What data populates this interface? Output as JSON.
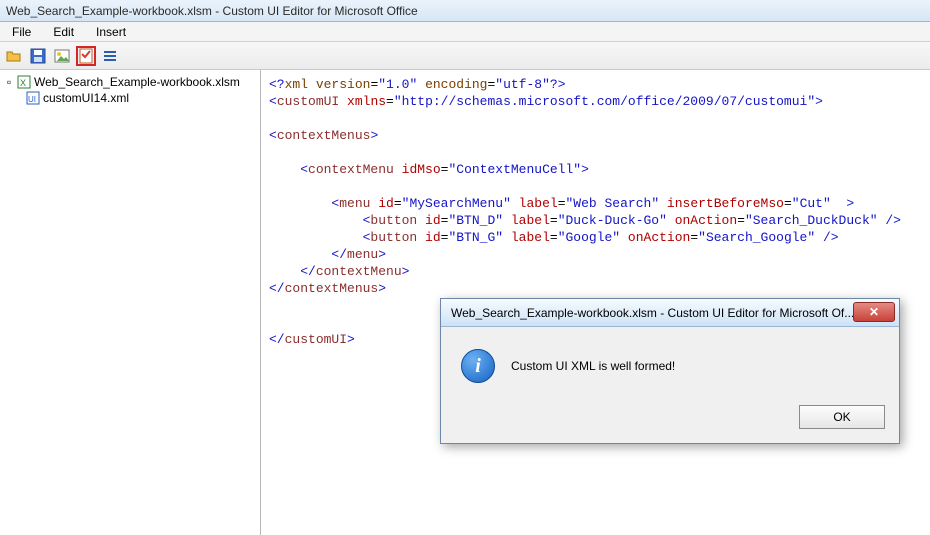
{
  "window": {
    "title": "Web_Search_Example-workbook.xlsm - Custom UI Editor for Microsoft Office"
  },
  "menu": {
    "file": "File",
    "edit": "Edit",
    "insert": "Insert"
  },
  "toolbar_icons": [
    "open",
    "save",
    "image",
    "validate",
    "generate"
  ],
  "tree": {
    "root": "Web_Search_Example-workbook.xlsm",
    "child": "customUI14.xml"
  },
  "xml": {
    "l1": {
      "a": "<?",
      "b": "xml version",
      "c": "=",
      "d": "\"1.0\"",
      "e": " encoding",
      "f": "=",
      "g": "\"utf-8\"",
      "h": "?>"
    },
    "l2": {
      "a": "<",
      "b": "customUI",
      "c": " xmlns",
      "d": "=",
      "e": "\"http://schemas.microsoft.com/office/2009/07/customui\"",
      "f": ">"
    },
    "l3": "",
    "l4": {
      "a": "<",
      "b": "contextMenus",
      "c": ">"
    },
    "l5": "",
    "l6": {
      "a": "    <",
      "b": "contextMenu",
      "c": " idMso",
      "d": "=",
      "e": "\"ContextMenuCell\"",
      "f": ">"
    },
    "l7": "",
    "l8": {
      "a": "        <",
      "b": "menu",
      "c": " id",
      "d": "=",
      "e": "\"MySearchMenu\"",
      "f": " label",
      "g": "=",
      "h": "\"Web Search\"",
      "i": " insertBeforeMso",
      "j": "=",
      "k": "\"Cut\"",
      "l": "  >"
    },
    "l9": {
      "a": "            <",
      "b": "button",
      "c": " id",
      "d": "=",
      "e": "\"BTN_D\"",
      "f": " label",
      "g": "=",
      "h": "\"Duck-Duck-Go\"",
      "i": " onAction",
      "j": "=",
      "k": "\"Search_DuckDuck\"",
      "l": " />"
    },
    "l10": {
      "a": "            <",
      "b": "button",
      "c": " id",
      "d": "=",
      "e": "\"BTN_G\"",
      "f": " label",
      "g": "=",
      "h": "\"Google\"",
      "i": " onAction",
      "j": "=",
      "k": "\"Search_Google\"",
      "l": " />"
    },
    "l11": {
      "a": "        </",
      "b": "menu",
      "c": ">"
    },
    "l12": {
      "a": "    </",
      "b": "contextMenu",
      "c": ">"
    },
    "l13": {
      "a": "</",
      "b": "contextMenus",
      "c": ">"
    },
    "l14": "",
    "l15": "",
    "l16": {
      "a": "</",
      "b": "customUI",
      "c": ">"
    }
  },
  "dialog": {
    "title": "Web_Search_Example-workbook.xlsm - Custom UI Editor for Microsoft Of...",
    "message": "Custom UI XML is well formed!",
    "ok_label": "OK",
    "info_glyph": "i",
    "close_glyph": "✕"
  }
}
